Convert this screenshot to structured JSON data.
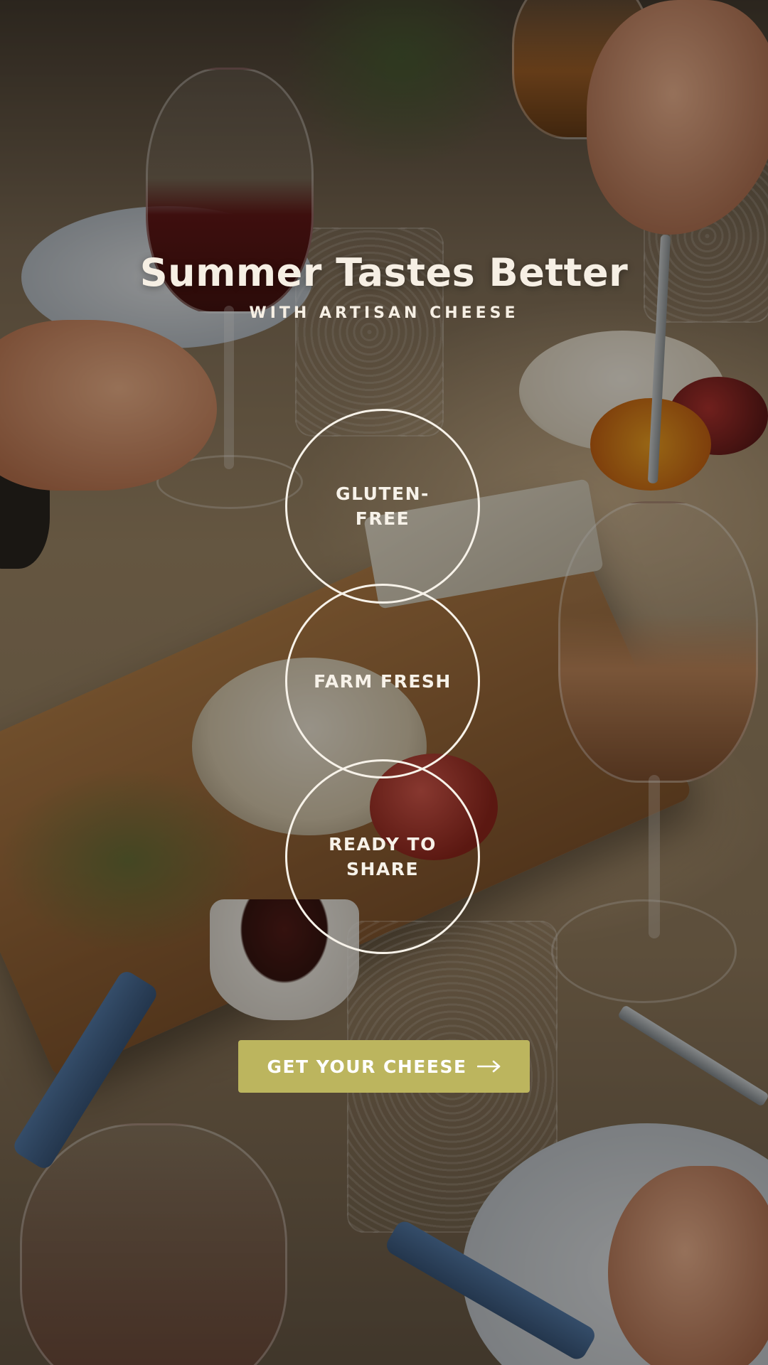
{
  "hero": {
    "title": "Summer Tastes Better",
    "subtitle": "WITH ARTISAN CHEESE",
    "background": "artisan-cheese-board-photo"
  },
  "features": [
    {
      "label": "GLUTEN-FREE"
    },
    {
      "label": "FARM FRESH"
    },
    {
      "label": "READY TO SHARE"
    }
  ],
  "cta": {
    "label": "GET YOUR CHEESE",
    "icon": "arrow-right-icon",
    "color": "#bcb55e"
  },
  "colors": {
    "text": "#f6efe4",
    "circle_border": "#f7f2e9",
    "button": "#bcb55e"
  }
}
